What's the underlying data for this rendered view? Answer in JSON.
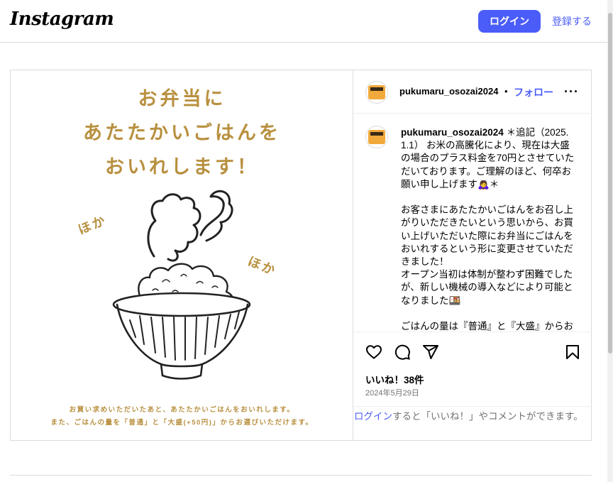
{
  "nav": {
    "logo": "Instagram",
    "login_label": "ログイン",
    "signup_label": "登録する"
  },
  "post": {
    "image": {
      "headline": [
        "お弁当に",
        "あたたかいごはんを",
        "おいれします！"
      ],
      "hoka_left": "ほか",
      "hoka_right": "ほか",
      "notes": [
        "お買い求めいただいたあと、あたたかいごはんをおいれします。",
        "また、ごはんの量を「普通」と「大盛(+50円)」からお選びいただけます。"
      ]
    },
    "author": {
      "username": "pukumaru_osozai2024",
      "separator": "•",
      "follow_label": "フォロー"
    },
    "caption": {
      "username": "pukumaru_osozai2024",
      "text": " ＊追記（2025.1.1） お米の高騰化により、現在は大盛の場合のプラス料金を70円とさせていただいております。ご理解のほど、何卒お願い申し上げます🙇‍♀️＊\n\nお客さまにあたたかいごはんをお召し上がりいただきたいという思いから、お買い上げいただいた際にお弁当にごはんをおいれするという形に変更させていただきました！\nオープン当初は体制が整わず困難でしたが、新しい機械の導入などにより可能となりました🍱\n\nごはんの量は『普通』と『大盛』からお選びいただけます。"
    },
    "likes": "いいね！38件",
    "date": "2024年5月29日",
    "footer": {
      "login_link": "ログイン",
      "rest": "すると「いいね！」やコメントができます。"
    }
  },
  "colors": {
    "accent": "#4a5df9",
    "gold": "#b8903f"
  }
}
